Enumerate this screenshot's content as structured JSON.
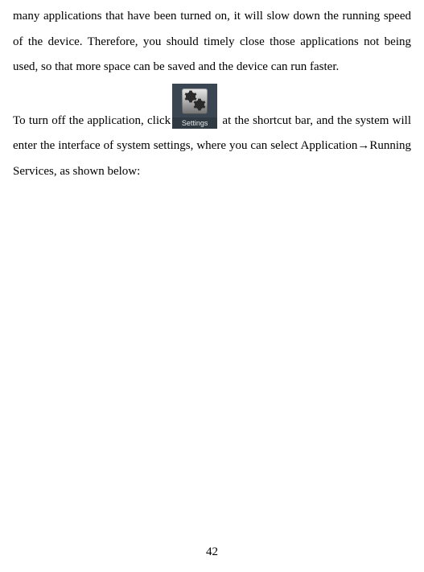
{
  "para1": "many applications that have been turned on, it will slow down the running speed of the device. Therefore, you should timely close those applications not being used, so that more space can be saved and the device can run faster.",
  "para2_pre": "To turn off the application, click",
  "para2_post": " at the shortcut bar, and the system will enter the interface of system settings, where you can select Application→Running Services, as shown below:",
  "icon_label": "Settings",
  "page_number": "42"
}
